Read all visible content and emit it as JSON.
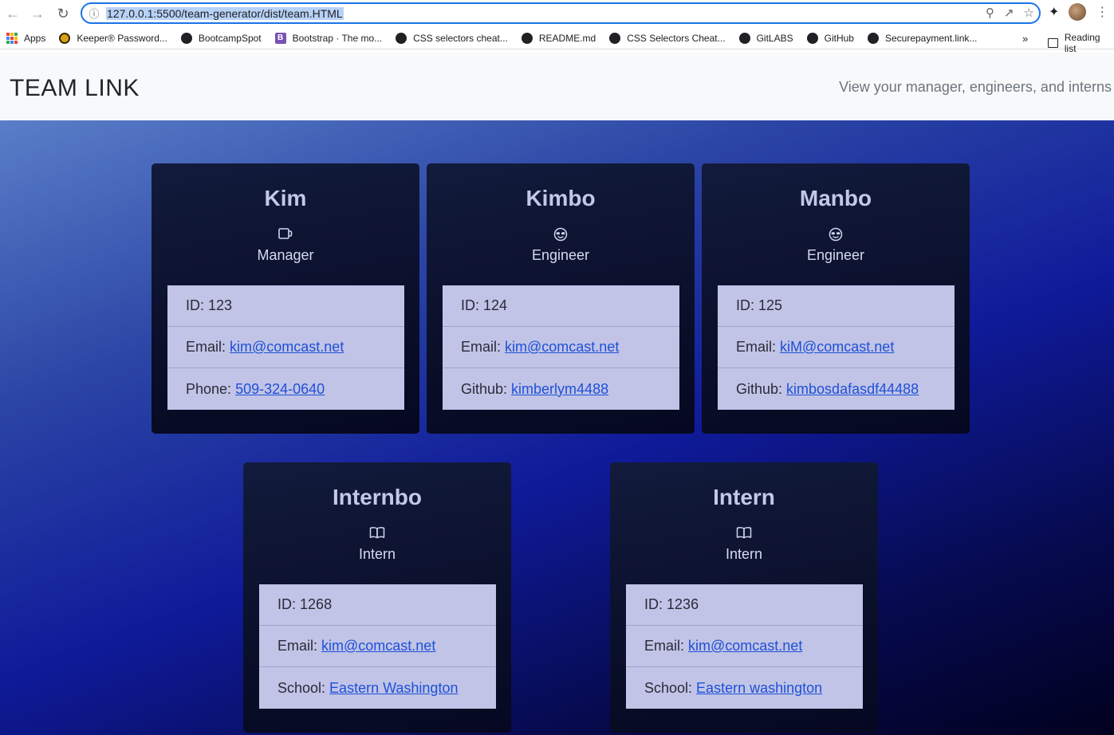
{
  "browser": {
    "url": "127.0.0.1:5500/team-generator/dist/team.HTML",
    "bookmarks": [
      "Apps",
      "Keeper® Password...",
      "BootcampSpot",
      "Bootstrap · The mo...",
      "CSS selectors cheat...",
      "README.md",
      "CSS Selectors Cheat...",
      "GitLABS",
      "GitHub",
      "Securepayment.link..."
    ],
    "more": "»",
    "reading_list": "Reading list"
  },
  "navbar": {
    "brand": "TEAM LINK",
    "tagline": "View your manager, engineers, and interns"
  },
  "cards": [
    {
      "name": "Kim",
      "role": "Manager",
      "icon": "mug-icon",
      "id_label": "ID:",
      "id": "123",
      "email_label": "Email:",
      "email": "kim@comcast.net",
      "extra_label": "Phone:",
      "extra": "509-324-0640"
    },
    {
      "name": "Kimbo",
      "role": "Engineer",
      "icon": "sunglasses-face-icon",
      "id_label": "ID:",
      "id": "124",
      "email_label": "Email:",
      "email": "kim@comcast.net",
      "extra_label": "Github:",
      "extra": "kimberlym4488"
    },
    {
      "name": "Manbo",
      "role": "Engineer",
      "icon": "sunglasses-face-icon",
      "id_label": "ID:",
      "id": "125",
      "email_label": "Email:",
      "email": "kiM@comcast.net",
      "extra_label": "Github:",
      "extra": "kimbosdafasdf44488"
    },
    {
      "name": "Internbo",
      "role": "Intern",
      "icon": "open-book-icon",
      "id_label": "ID:",
      "id": "1268",
      "email_label": "Email:",
      "email": "kim@comcast.net",
      "extra_label": "School:",
      "extra": "Eastern Washington"
    },
    {
      "name": "Intern",
      "role": "Intern",
      "icon": "open-book-icon",
      "id_label": "ID:",
      "id": "1236",
      "email_label": "Email:",
      "email": "kim@comcast.net",
      "extra_label": "School:",
      "extra": "Eastern washington"
    }
  ]
}
